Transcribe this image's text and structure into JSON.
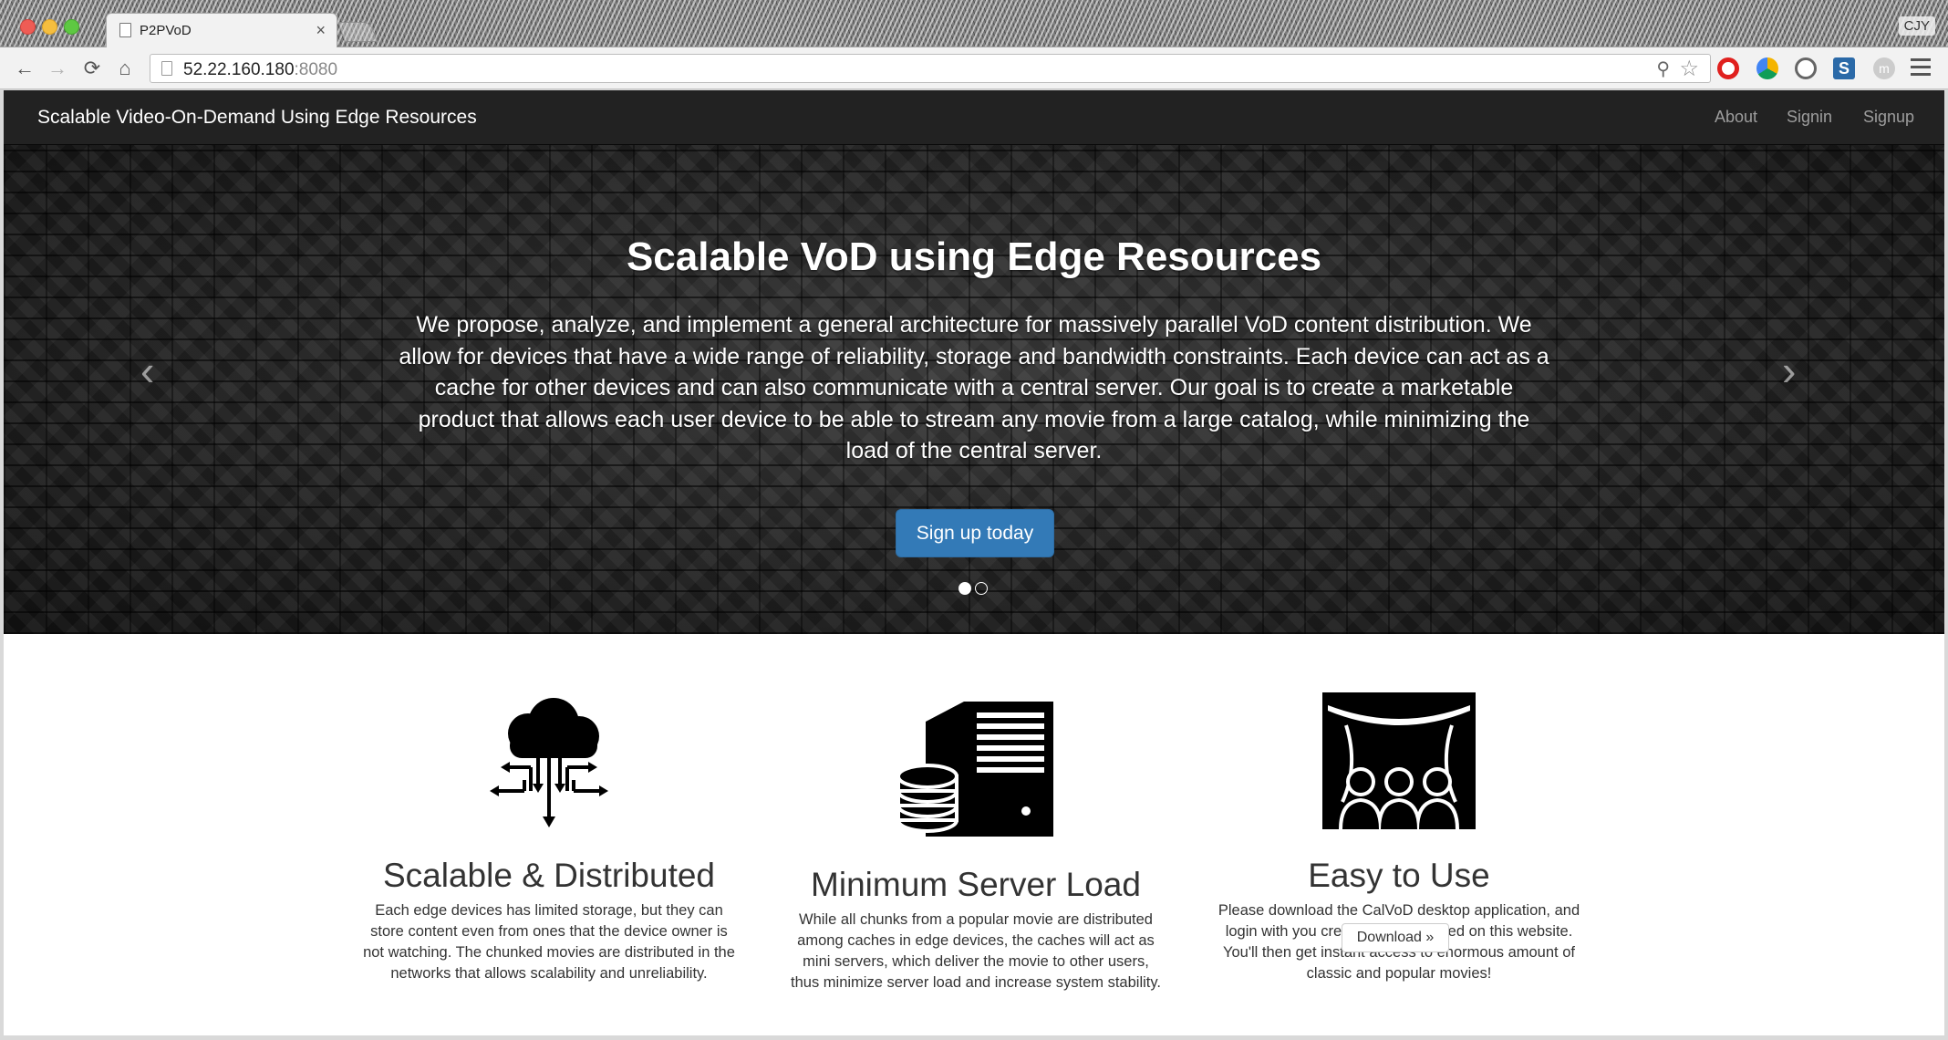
{
  "browser": {
    "tab_title": "P2PVoD",
    "tab_close": "×",
    "profile": "CJY",
    "url_host": "52.22.160.180",
    "url_port": ":8080",
    "back": "←",
    "forward": "→",
    "reload": "⟳",
    "home": "⌂",
    "zoom": "⚲",
    "star": "☆",
    "ext_s": "S",
    "ext_m": "m"
  },
  "navbar": {
    "brand": "Scalable Video-On-Demand Using Edge Resources",
    "links": [
      "About",
      "Signin",
      "Signup"
    ]
  },
  "hero": {
    "title": "Scalable VoD using Edge Resources",
    "text": "We propose, analyze, and implement a general architecture for massively parallel VoD content distribution. We allow for devices that have a wide range of reliability, storage and bandwidth constraints. Each device can act as a cache for other devices and can also communicate with a central server. Our goal is to create a marketable product that allows each user device to be able to stream any movie from a large catalog, while minimizing the load of the central server.",
    "button": "Sign up today",
    "prev": "‹",
    "next": "›",
    "slides": 2,
    "active_slide": 1
  },
  "features": [
    {
      "icon": "cloud-network-icon",
      "heading": "Scalable & Distributed",
      "text": "Each edge devices has limited storage, but they can store content even from ones that the device owner is not watching. The chunked movies are distributed in the networks that allows scalability and unreliability."
    },
    {
      "icon": "server-database-icon",
      "heading": "Minimum Server Load",
      "text": "While all chunks from a popular movie are distributed among caches in edge devices, the caches will act as mini servers, which deliver the movie to other users, thus minimize server load and increase system stability."
    },
    {
      "icon": "theater-audience-icon",
      "heading": "Easy to Use",
      "text": "Please download the CalVoD desktop application, and login with you credentials registered on this website. You'll then get instant access to enormous amount of classic and popular movies!",
      "button": "Download »"
    }
  ],
  "colors": {
    "navbar": "#222222",
    "primary": "#337ab7"
  }
}
